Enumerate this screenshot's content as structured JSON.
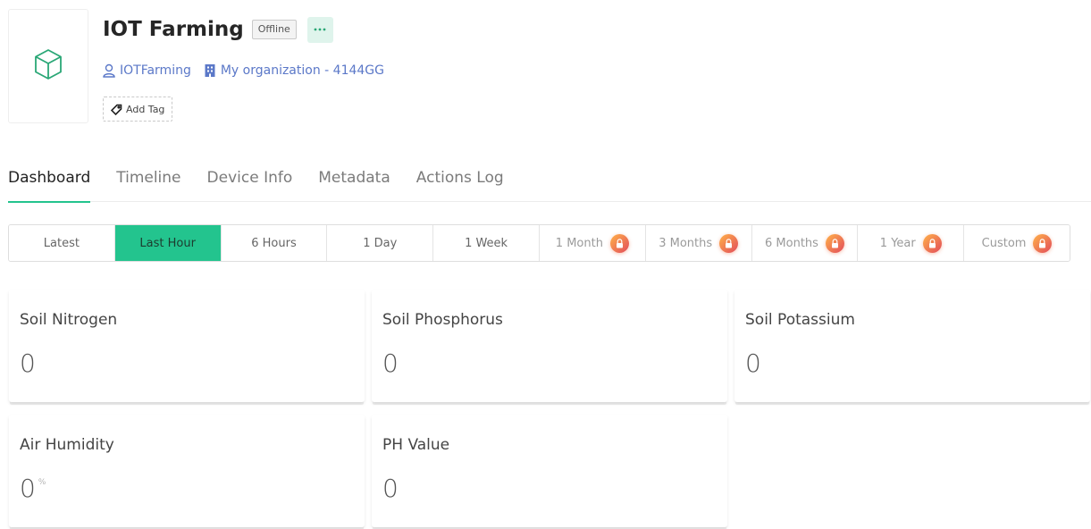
{
  "header": {
    "title": "IOT Farming",
    "status": "Offline",
    "more_label": "•••",
    "owner": "IOTFarming",
    "organization": "My organization - 4144GG",
    "add_tag_label": "Add Tag",
    "icon": "box-icon"
  },
  "tabs": [
    "Dashboard",
    "Timeline",
    "Device Info",
    "Metadata",
    "Actions Log"
  ],
  "active_tab": "Dashboard",
  "time_range": {
    "options": [
      {
        "label": "Latest",
        "locked": false
      },
      {
        "label": "Last Hour",
        "locked": false,
        "selected": true
      },
      {
        "label": "6 Hours",
        "locked": false
      },
      {
        "label": "1 Day",
        "locked": false
      },
      {
        "label": "1 Week",
        "locked": false
      },
      {
        "label": "1 Month",
        "locked": true
      },
      {
        "label": "3 Months",
        "locked": true
      },
      {
        "label": "6 Months",
        "locked": true
      },
      {
        "label": "1 Year",
        "locked": true
      },
      {
        "label": "Custom",
        "locked": true
      }
    ]
  },
  "widgets": [
    {
      "title": "Soil Nitrogen",
      "value": "0",
      "unit": ""
    },
    {
      "title": "Soil Phosphorus",
      "value": "0",
      "unit": ""
    },
    {
      "title": "Soil Potassium",
      "value": "0",
      "unit": ""
    },
    {
      "title": "Air Humidity",
      "value": "0",
      "unit": "%"
    },
    {
      "title": "PH Value",
      "value": "0",
      "unit": ""
    }
  ],
  "colors": {
    "accent": "#23c48e",
    "link": "#5b78c8",
    "lock_gradient_start": "#ffb347",
    "lock_gradient_end": "#e24b5c"
  }
}
